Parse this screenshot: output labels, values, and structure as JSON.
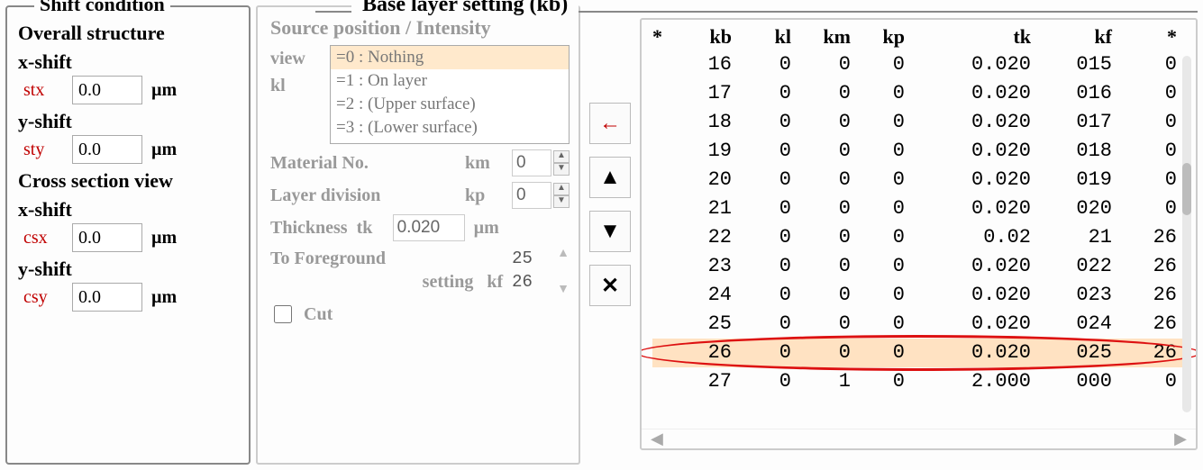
{
  "left": {
    "legend": "Shift condition",
    "overall_title": "Overall structure",
    "cross_title": "Cross section view",
    "xshift_label": "x-shift",
    "yshift_label": "y-shift",
    "unit": "µm",
    "stx": {
      "name": "stx",
      "value": "0.0"
    },
    "sty": {
      "name": "sty",
      "value": "0.0"
    },
    "csx": {
      "name": "csx",
      "value": "0.0"
    },
    "csy": {
      "name": "csy",
      "value": "0.0"
    }
  },
  "mid": {
    "title": "Source position / Intensity",
    "view_label": "view",
    "kl_label": "kl",
    "listbox": {
      "options": [
        "=0 : Nothing",
        "=1 : On layer",
        "=2 : (Upper surface)",
        "=3 : (Lower surface)"
      ],
      "selected_index": 0
    },
    "material": {
      "label": "Material No.",
      "var": "km",
      "value": "0"
    },
    "division": {
      "label": "Layer division",
      "var": "kp",
      "value": "0"
    },
    "thickness": {
      "label": "Thickness",
      "var": "tk",
      "value": "0.020",
      "unit": "µm"
    },
    "foreground": {
      "label1": "To Foreground",
      "label2": "setting",
      "var": "kf",
      "values": [
        "25",
        "26"
      ]
    },
    "cut_label": "Cut",
    "cut_checked": false
  },
  "buttons": {
    "back": "←",
    "up": "▲",
    "down": "▼",
    "delete": "✕"
  },
  "right": {
    "legend": "Base layer setting (kb)",
    "columns": [
      "*",
      "kb",
      "kl",
      "km",
      "kp",
      "tk",
      "kf",
      "*"
    ],
    "highlighted_index": 10,
    "rows": [
      {
        "kb": "16",
        "kl": "0",
        "km": "0",
        "kp": "0",
        "tk": "0.020",
        "kf": "015",
        "star": "0"
      },
      {
        "kb": "17",
        "kl": "0",
        "km": "0",
        "kp": "0",
        "tk": "0.020",
        "kf": "016",
        "star": "0"
      },
      {
        "kb": "18",
        "kl": "0",
        "km": "0",
        "kp": "0",
        "tk": "0.020",
        "kf": "017",
        "star": "0"
      },
      {
        "kb": "19",
        "kl": "0",
        "km": "0",
        "kp": "0",
        "tk": "0.020",
        "kf": "018",
        "star": "0"
      },
      {
        "kb": "20",
        "kl": "0",
        "km": "0",
        "kp": "0",
        "tk": "0.020",
        "kf": "019",
        "star": "0"
      },
      {
        "kb": "21",
        "kl": "0",
        "km": "0",
        "kp": "0",
        "tk": "0.020",
        "kf": "020",
        "star": "0"
      },
      {
        "kb": "22",
        "kl": "0",
        "km": "0",
        "kp": "0",
        "tk": "0.02",
        "kf": "21",
        "star": "26"
      },
      {
        "kb": "23",
        "kl": "0",
        "km": "0",
        "kp": "0",
        "tk": "0.020",
        "kf": "022",
        "star": "26"
      },
      {
        "kb": "24",
        "kl": "0",
        "km": "0",
        "kp": "0",
        "tk": "0.020",
        "kf": "023",
        "star": "26"
      },
      {
        "kb": "25",
        "kl": "0",
        "km": "0",
        "kp": "0",
        "tk": "0.020",
        "kf": "024",
        "star": "26"
      },
      {
        "kb": "26",
        "kl": "0",
        "km": "0",
        "kp": "0",
        "tk": "0.020",
        "kf": "025",
        "star": "26"
      },
      {
        "kb": "27",
        "kl": "0",
        "km": "1",
        "kp": "0",
        "tk": "2.000",
        "kf": "000",
        "star": "0"
      }
    ]
  }
}
